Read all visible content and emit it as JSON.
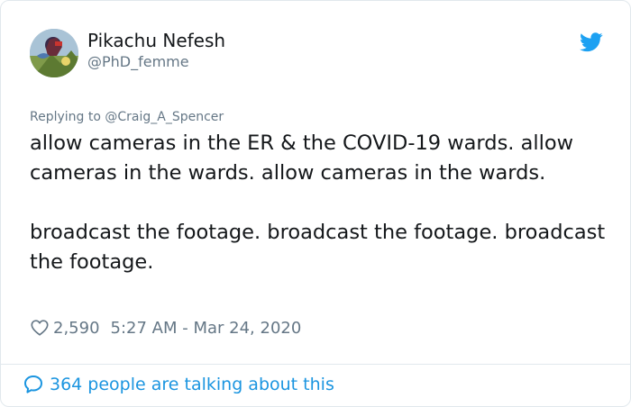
{
  "author": {
    "name": "Pikachu Nefesh",
    "handle": "@PhD_femme",
    "avatar_icon": "avatar-image"
  },
  "reply": {
    "prefix": "Replying to",
    "target": "@Craig_A_Spencer"
  },
  "tweet": {
    "text": "allow cameras in the ER & the COVID-19 wards. allow cameras in the wards. allow cameras in the wards.\n\nbroadcast the footage. broadcast the footage. broadcast the footage.",
    "likes": "2,590",
    "timestamp": "5:27 AM - Mar 24, 2020"
  },
  "footer": {
    "talking_label": "364 people are talking about this"
  },
  "colors": {
    "accent": "#1da1f2",
    "link": "#1b95e0",
    "muted": "#657786",
    "text": "#14171a",
    "border": "#e1e8ed"
  },
  "icons": {
    "brand": "twitter-bird-icon",
    "like": "heart-icon",
    "conversation": "speech-bubble-icon"
  }
}
